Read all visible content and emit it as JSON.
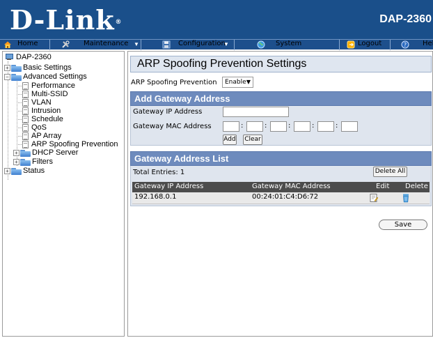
{
  "header": {
    "brand": "D-Link",
    "brand_mark": "®",
    "model": "DAP-2360"
  },
  "menu": [
    {
      "label": "Home",
      "icon": "home-icon"
    },
    {
      "label": "Maintenance",
      "icon": "tools-icon",
      "dropdown": true
    },
    {
      "label": "Configuration",
      "icon": "floppy-icon",
      "dropdown": true
    },
    {
      "label": "System",
      "icon": "globe-icon"
    },
    {
      "label": "Logout",
      "icon": "logout-icon"
    },
    {
      "label": "Help",
      "icon": "help-icon"
    }
  ],
  "tree": {
    "root": "DAP-2360",
    "basic": "Basic Settings",
    "advanced": "Advanced Settings",
    "advanced_items": [
      "Performance",
      "Multi-SSID",
      "VLAN",
      "Intrusion",
      "Schedule",
      "QoS",
      "AP Array",
      "ARP Spoofing Prevention"
    ],
    "dhcp": "DHCP Server",
    "filters": "Filters",
    "status": "Status"
  },
  "page": {
    "title": "ARP Spoofing Prevention Settings",
    "arp_label": "ARP Spoofing Prevention",
    "arp_value": "Enable",
    "add_section": "Add Gateway Address",
    "gw_ip_label": "Gateway IP Address",
    "gw_mac_label": "Gateway MAC Address",
    "add_button": "Add",
    "clear_button": "Clear",
    "list_section": "Gateway Address List",
    "total_entries": "Total Entries: 1",
    "delete_all": "Delete All",
    "columns": [
      "Gateway IP Address",
      "Gateway MAC Address",
      "Edit",
      "Delete"
    ],
    "rows": [
      {
        "ip": "192.168.0.1",
        "mac": "00:24:01:C4:D6:72"
      }
    ],
    "save_button": "Save"
  },
  "colors": {
    "header_bg": "#1a4f8a",
    "section_head": "#6e8bbd",
    "table_head": "#4c4c4c"
  }
}
